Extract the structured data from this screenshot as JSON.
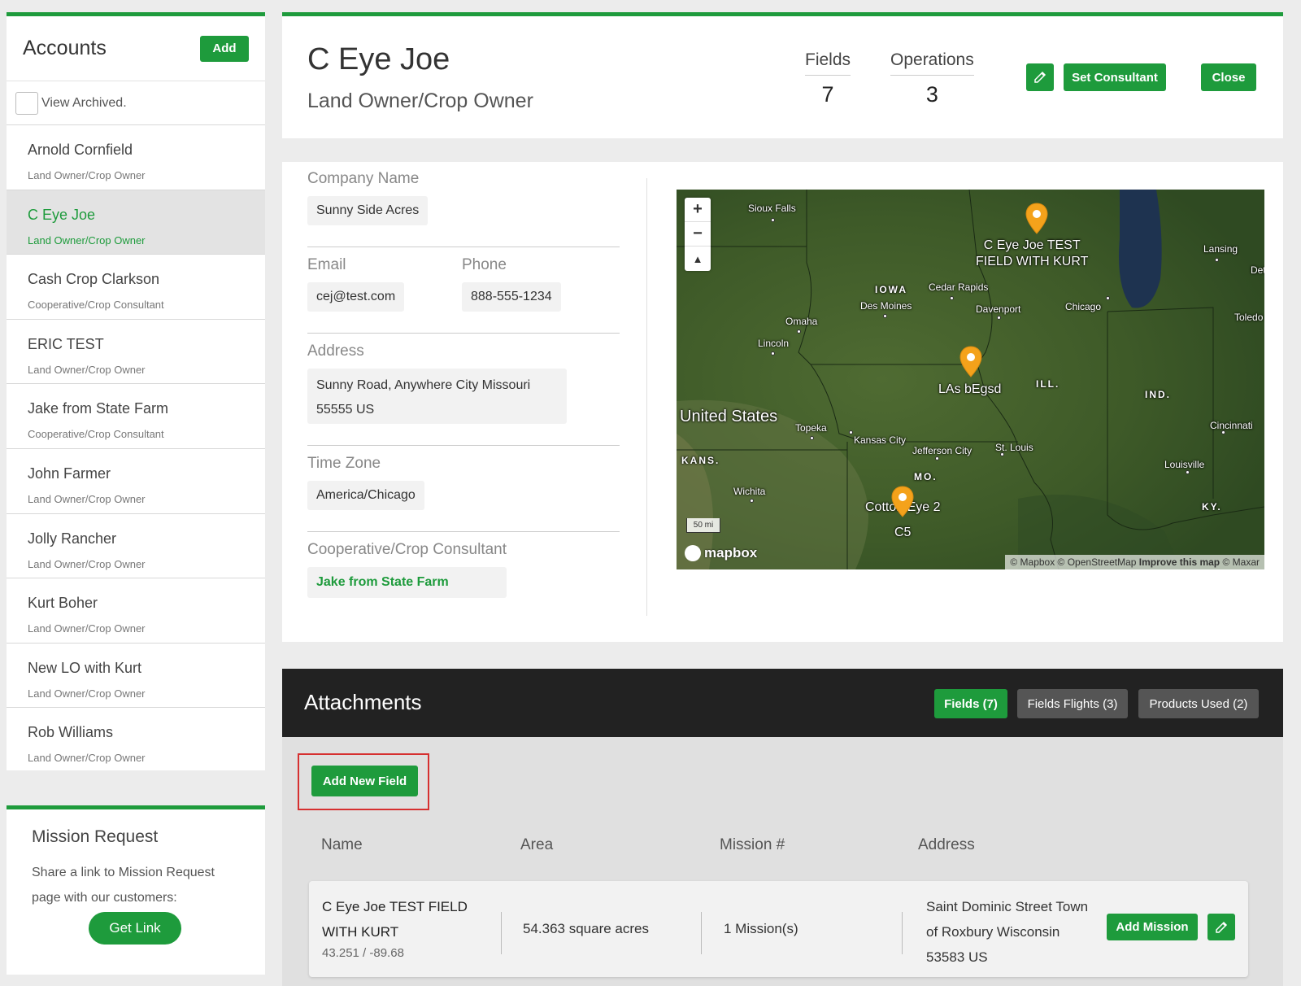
{
  "sidebar": {
    "title": "Accounts",
    "add_label": "Add",
    "archived_label": "View Archived.",
    "items": [
      {
        "name": "Arnold Cornfield",
        "role": "Land Owner/Crop Owner"
      },
      {
        "name": "C Eye Joe",
        "role": "Land Owner/Crop Owner"
      },
      {
        "name": "Cash Crop Clarkson",
        "role": "Cooperative/Crop Consultant"
      },
      {
        "name": "ERIC TEST",
        "role": "Land Owner/Crop Owner"
      },
      {
        "name": "Jake from State Farm",
        "role": "Cooperative/Crop Consultant"
      },
      {
        "name": "John Farmer",
        "role": "Land Owner/Crop Owner"
      },
      {
        "name": "Jolly Rancher",
        "role": "Land Owner/Crop Owner"
      },
      {
        "name": "Kurt Boher",
        "role": "Land Owner/Crop Owner"
      },
      {
        "name": "New LO with Kurt",
        "role": "Land Owner/Crop Owner"
      },
      {
        "name": "Rob Williams",
        "role": "Land Owner/Crop Owner"
      }
    ]
  },
  "mission": {
    "title": "Mission Request",
    "text": "Share a link to Mission Request page with our customers:",
    "button": "Get Link"
  },
  "account": {
    "name": "C Eye Joe",
    "role": "Land Owner/Crop Owner",
    "fields_label": "Fields",
    "fields_value": "7",
    "operations_label": "Operations",
    "operations_value": "3",
    "set_consultant": "Set Consultant",
    "close": "Close"
  },
  "details": {
    "company_label": "Company Name",
    "company_value": "Sunny Side Acres",
    "email_label": "Email",
    "email_value": "cej@test.com",
    "phone_label": "Phone",
    "phone_value": "888-555-1234",
    "address_label": "Address",
    "address_line1": "Sunny Road, Anywhere City Missouri",
    "address_line2": "55555 US",
    "timezone_label": "Time Zone",
    "timezone_value": "America/Chicago",
    "consultant_label": "Cooperative/Crop Consultant",
    "consultant_value": "Jake from State Farm"
  },
  "map": {
    "labels": {
      "sioux_falls": "Sioux Falls",
      "iowa": "IOWA",
      "cedar_rapids": "Cedar Rapids",
      "des_moines": "Des Moines",
      "davenport": "Davenport",
      "chicago": "Chicago",
      "lansing": "Lansing",
      "det": "Det",
      "toledo": "Toledo",
      "omaha": "Omaha",
      "lincoln": "Lincoln",
      "ill": "ILL.",
      "ind": "IND.",
      "united_states": "United States",
      "topeka": "Topeka",
      "kansas_city": "Kansas City",
      "jefferson_city": "Jefferson City",
      "st_louis": "St. Louis",
      "cincinnati": "Cincinnati",
      "kans": "KANS.",
      "mo": "MO.",
      "wichita": "Wichita",
      "louisville": "Louisville",
      "ky": "KY.",
      "pin1": "C Eye Joe TEST\nFIELD WITH KURT",
      "pin2": "LAs bEgsd",
      "pin3": "Cotton Eye 2",
      "pin3b": "C5"
    },
    "scale": "50 mi",
    "logo": "mapbox",
    "attrib_a": "© Mapbox © OpenStreetMap",
    "attrib_b": "Improve this map",
    "attrib_c": "© Maxar"
  },
  "attachments": {
    "title": "Attachments",
    "tabs": [
      "Fields (7)",
      "Fields Flights (3)",
      "Products Used (2)"
    ],
    "add_field": "Add New Field",
    "columns": [
      "Name",
      "Area",
      "Mission #",
      "Address"
    ],
    "rows": [
      {
        "name": "C Eye Joe TEST FIELD WITH KURT",
        "coords": "43.251 / -89.68",
        "area": "54.363 square acres",
        "missions": "1 Mission(s)",
        "address": "Saint Dominic Street Town of Roxbury Wisconsin 53583 US",
        "add_mission": "Add Mission"
      }
    ]
  },
  "colors": {
    "accent": "#1e9b3c",
    "header_dark": "#222222",
    "highlight": "#d63030"
  }
}
